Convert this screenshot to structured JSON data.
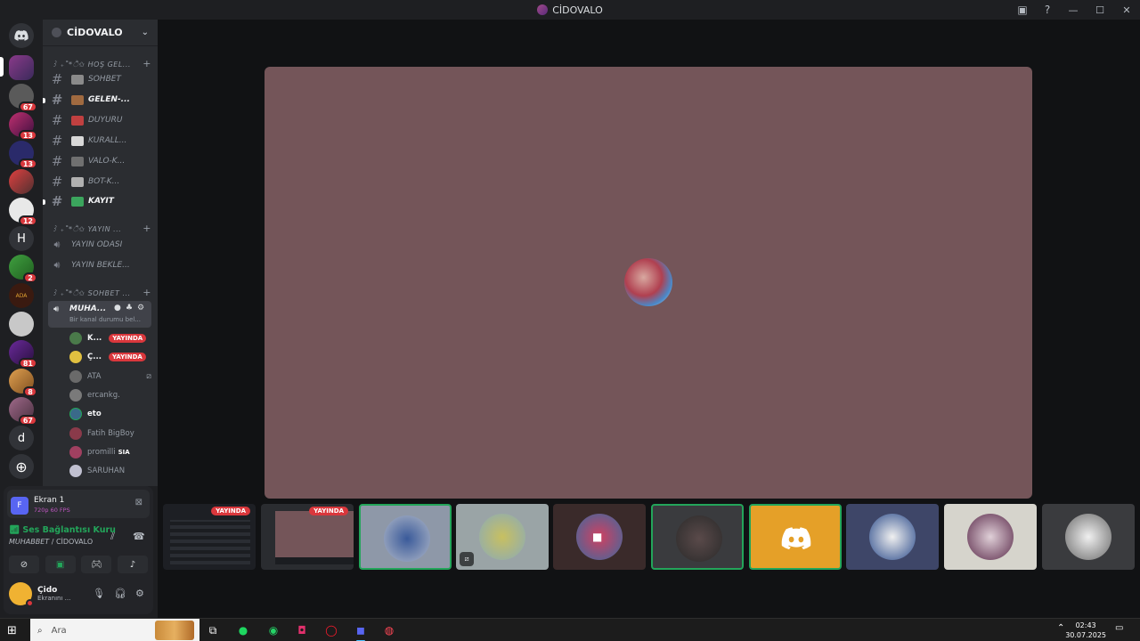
{
  "window": {
    "title": "CİDOVALO"
  },
  "rail": {
    "badges": [
      "67",
      "13",
      "13",
      "12",
      "2",
      "81",
      "8",
      "67"
    ],
    "letters": [
      "H",
      "d"
    ],
    "logo_text": "ADA"
  },
  "server": {
    "name": "CİDOVALO"
  },
  "categories": [
    "꒱ ₊˚*ੈ✩ HOŞ GEL...",
    "꒱ ₊˚*ੈ✩ YAYIN ...",
    "꒱ ₊˚*ੈ✩ SOHBET ..."
  ],
  "channels": {
    "c1": "SOHBET",
    "c2": "GELEN-...",
    "c3": "DUYURU",
    "c4": "KURALL...",
    "c5": "VALO-K...",
    "c6": "BOT-K...",
    "c7": "KAYIT",
    "v1": "YAYIN ODASI",
    "v2": "YAYIN BEKLE...",
    "v3": "MUHA...",
    "v3_status": "Bir kanal durumu bel..."
  },
  "members": {
    "m1": "K...",
    "m2": "Ç...",
    "m3": "ATA",
    "m4": "ercankg.",
    "m5": "eto",
    "m6": "Fatih BigBoy",
    "m7": "promilli",
    "m7_tag": "SIA",
    "m8": "SARUHAN",
    "live_label": "YAYINDA"
  },
  "panel": {
    "screen_title": "Ekran 1",
    "screen_quality": "720p 60 FPS",
    "screen_letter": "F",
    "voice_status": "Ses Bağlantısı Kuru",
    "voice_channel": "MUHABBET",
    "voice_server": " / CİDOVALO",
    "user_name": "Çido",
    "user_status": "Ekranını ..."
  },
  "stage": {},
  "tiles": {
    "live_label": "YAYINDA"
  },
  "taskbar": {
    "search_placeholder": "Ara",
    "time": "02:43",
    "date": "30.07.2025"
  },
  "colors": {
    "stage_bg": "#745559",
    "live_red": "#da373c",
    "speaking_green": "#23a55a",
    "discord_tile": "#e5a028"
  }
}
